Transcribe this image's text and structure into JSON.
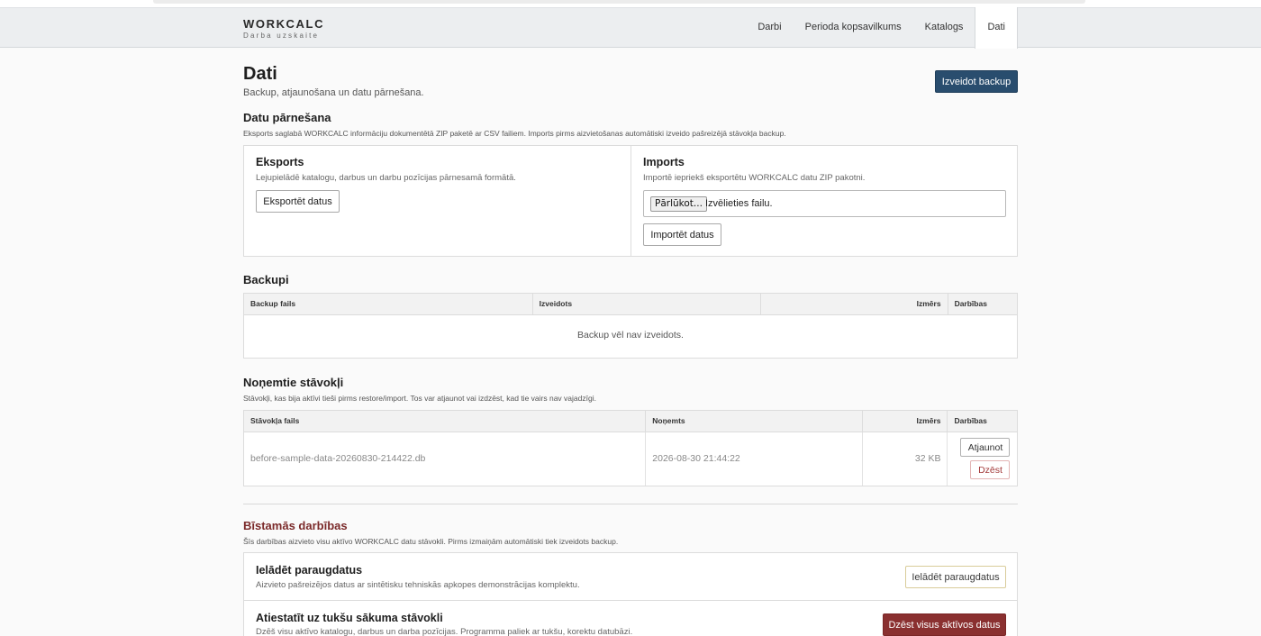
{
  "brand": {
    "title": "WORKCALC",
    "subtitle": "Darba uzskaite"
  },
  "nav": [
    {
      "label": "Darbi"
    },
    {
      "label": "Perioda kopsavilkums"
    },
    {
      "label": "Katalogs"
    },
    {
      "label": "Dati",
      "active": true
    }
  ],
  "page": {
    "title": "Dati",
    "subtitle": "Backup, atjaunošana un datu pārnešana.",
    "create_backup_label": "Izveidot backup"
  },
  "transfer": {
    "title": "Datu pārnešana",
    "description": "Eksports saglabā WORKCALC informāciju dokumentētā ZIP paketē ar CSV failiem. Imports pirms aizvietošanas automātiski izveido pašreizējā stāvokļa backup.",
    "export": {
      "title": "Eksports",
      "description": "Lejupielādē katalogu, darbus un darbu pozīcijas pārnesamā formātā.",
      "button": "Eksportēt datus"
    },
    "import": {
      "title": "Imports",
      "description": "Importē iepriekš eksportētu WORKCALC datu ZIP pakotni.",
      "browse_label": "Pārlūkot...",
      "file_status": "Izvēlieties failu.",
      "button": "Importēt datus"
    }
  },
  "backups": {
    "title": "Backupi",
    "columns": [
      "Backup fails",
      "Izveidots",
      "Izmērs",
      "Darbības"
    ],
    "empty_text": "Backup vēl nav izveidots."
  },
  "snapshots": {
    "title": "Noņemtie stāvokļi",
    "description": "Stāvokļi, kas bija aktīvi tieši pirms restore/import. Tos var atjaunot vai izdzēst, kad tie vairs nav vajadzīgi.",
    "columns": [
      "Stāvokļa fails",
      "Noņemts",
      "Izmērs",
      "Darbības"
    ],
    "rows": [
      {
        "file": "before-sample-data-20260830-214422.db",
        "removed": "2026-08-30 21:44:22",
        "size": "32 KB",
        "restore_label": "Atjaunot",
        "delete_label": "Dzēst"
      }
    ]
  },
  "danger": {
    "title": "Bīstamās darbības",
    "description": "Šīs darbības aizvieto visu aktīvo WORKCALC datu stāvokli. Pirms izmaiņām automātiski tiek izveidots backup.",
    "sample": {
      "title": "Ielādēt paraugdatus",
      "description": "Aizvieto pašreizējos datus ar sintētisku tehniskās apkopes demonstrācijas komplektu.",
      "button": "Ielādēt paraugdatus"
    },
    "reset": {
      "title": "Atiestatīt uz tukšu sākuma stāvokli",
      "description": "Dzēš visu aktīvo katalogu, darbus un darba pozīcijas. Programma paliek ar tukšu, korektu datubāzi.",
      "button": "Dzēst visus aktīvos datus"
    }
  },
  "colors": {
    "primary": "#294d6e",
    "danger": "#8a3030",
    "danger_title": "#7b2a2a",
    "nav_bg": "#eceef0"
  }
}
